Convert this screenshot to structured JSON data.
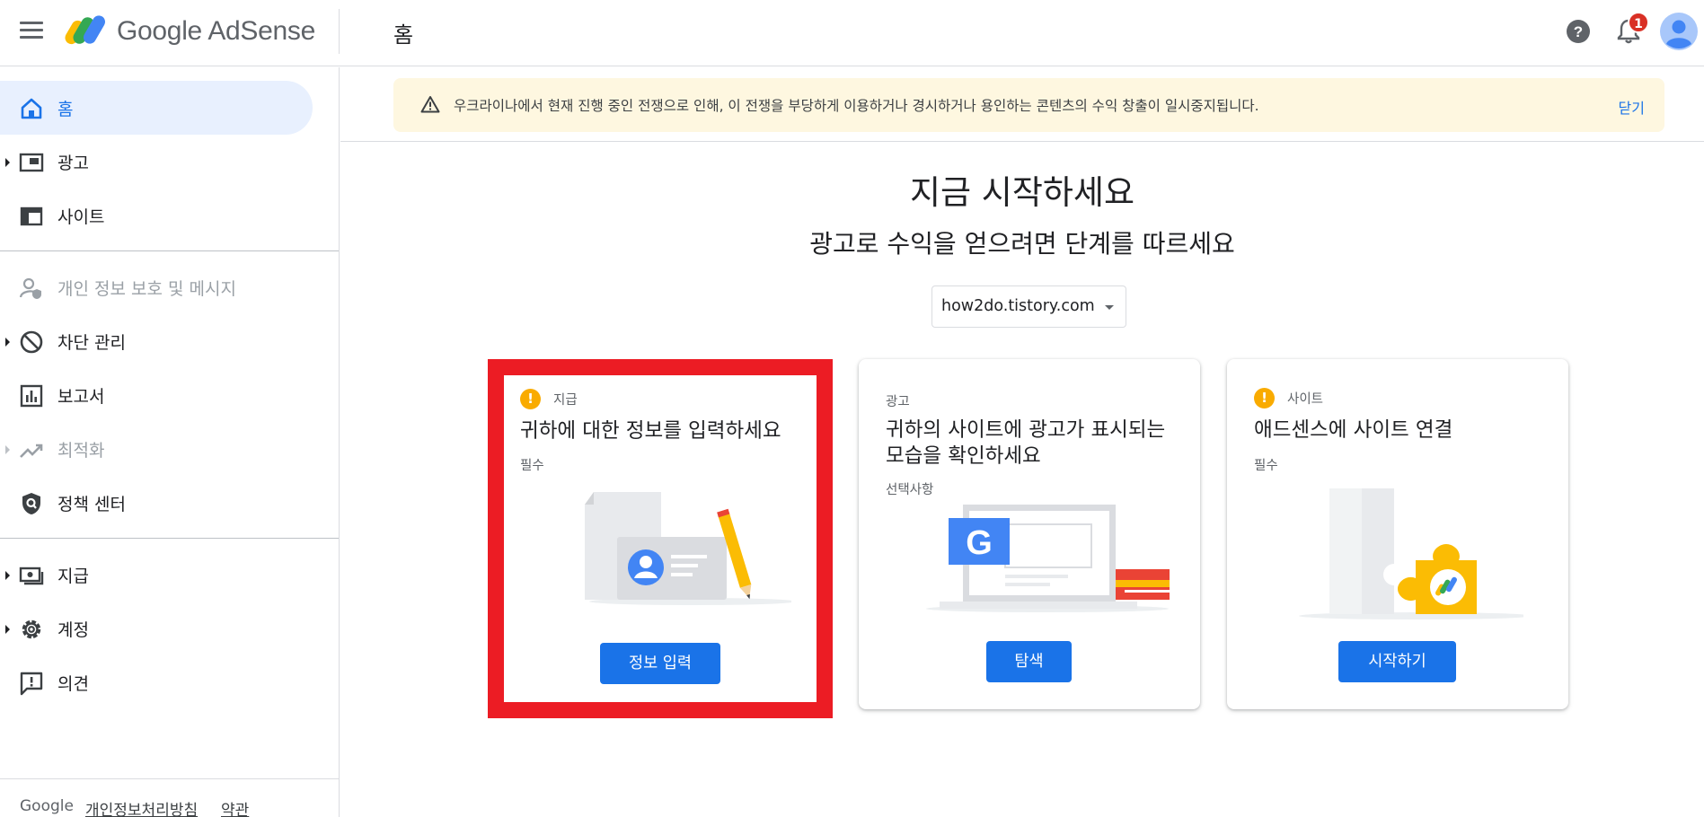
{
  "header": {
    "brand": "Google AdSense",
    "page_title": "홈",
    "notification_count": "1",
    "icons": [
      "menu-icon",
      "adsense-logo",
      "help-icon",
      "bell-icon",
      "avatar"
    ]
  },
  "sidebar": {
    "items": [
      {
        "label": "홈",
        "icon": "home-icon"
      },
      {
        "label": "광고",
        "icon": "ads-icon"
      },
      {
        "label": "사이트",
        "icon": "sites-icon"
      },
      {
        "label": "개인 정보 보호 및 메시지",
        "icon": "privacy-icon"
      },
      {
        "label": "차단 관리",
        "icon": "block-icon"
      },
      {
        "label": "보고서",
        "icon": "reports-icon"
      },
      {
        "label": "최적화",
        "icon": "optimize-icon"
      },
      {
        "label": "정책 센터",
        "icon": "policy-icon"
      },
      {
        "label": "지급",
        "icon": "payments-icon"
      },
      {
        "label": "계정",
        "icon": "gear-icon"
      },
      {
        "label": "의견",
        "icon": "feedback-icon"
      }
    ],
    "footer": {
      "brand": "Google",
      "privacy": "개인정보처리방침",
      "terms": "약관"
    }
  },
  "banner": {
    "text": "우크라이나에서 현재 진행 중인 전쟁으로 인해, 이 전쟁을 부당하게 이용하거나 경시하거나 용인하는 콘텐츠의 수익 창출이 일시중지됩니다.",
    "close": "닫기"
  },
  "main": {
    "title": "지금 시작하세요",
    "subtitle": "광고로 수익을 얻으려면 단계를 따르세요",
    "site_select": "how2do.tistory.com",
    "cards": [
      {
        "tag": "지급",
        "title": "귀하에 대한 정보를 입력하세요",
        "sub": "필수",
        "button": "정보 입력"
      },
      {
        "tag": "광고",
        "title": "귀하의 사이트에 광고가 표시되는 모습을 확인하세요",
        "sub": "선택사항",
        "button": "탐색"
      },
      {
        "tag": "사이트",
        "title": "애드센스에 사이트 연결",
        "sub": "필수",
        "button": "시작하기"
      }
    ]
  },
  "colors": {
    "accent": "#1a73e8",
    "highlight": "#ec1c24",
    "warning": "#f9ab00",
    "banner_bg": "#fef7e0"
  }
}
